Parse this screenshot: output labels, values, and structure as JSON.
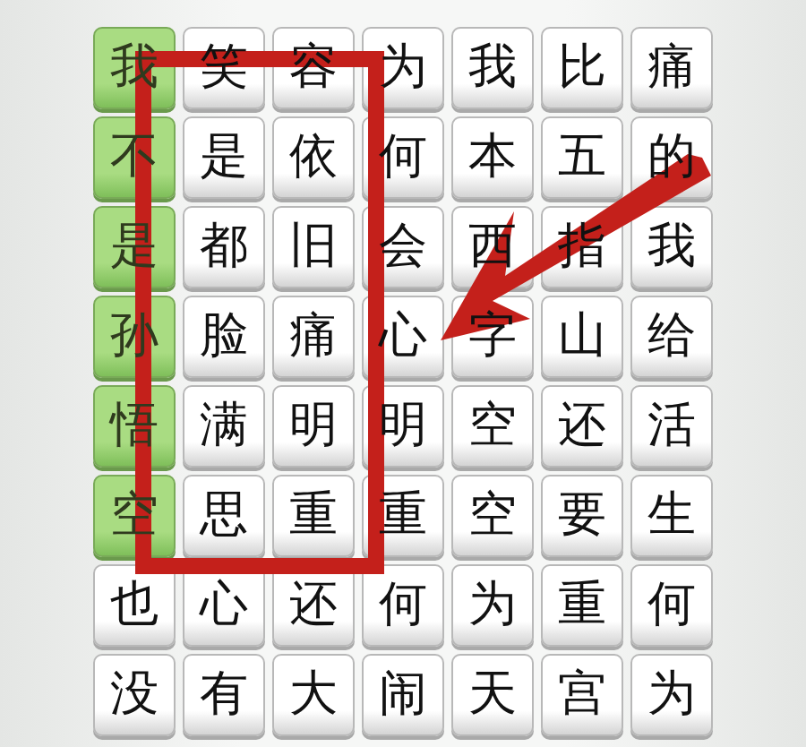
{
  "grid": [
    {
      "cells": [
        {
          "text": "我",
          "selected": true
        },
        {
          "text": "笑",
          "selected": false
        },
        {
          "text": "容",
          "selected": false
        },
        {
          "text": "为",
          "selected": false
        },
        {
          "text": "我",
          "selected": false
        },
        {
          "text": "比",
          "selected": false
        },
        {
          "text": "痛",
          "selected": false
        }
      ]
    },
    {
      "cells": [
        {
          "text": "不",
          "selected": true
        },
        {
          "text": "是",
          "selected": false
        },
        {
          "text": "依",
          "selected": false
        },
        {
          "text": "何",
          "selected": false
        },
        {
          "text": "本",
          "selected": false
        },
        {
          "text": "五",
          "selected": false
        },
        {
          "text": "的",
          "selected": false
        }
      ]
    },
    {
      "cells": [
        {
          "text": "是",
          "selected": true
        },
        {
          "text": "都",
          "selected": false
        },
        {
          "text": "旧",
          "selected": false
        },
        {
          "text": "会",
          "selected": false
        },
        {
          "text": "西",
          "selected": false
        },
        {
          "text": "指",
          "selected": false
        },
        {
          "text": "我",
          "selected": false
        }
      ]
    },
    {
      "cells": [
        {
          "text": "孙",
          "selected": true
        },
        {
          "text": "脸",
          "selected": false
        },
        {
          "text": "痛",
          "selected": false
        },
        {
          "text": "心",
          "selected": false
        },
        {
          "text": "字",
          "selected": false
        },
        {
          "text": "山",
          "selected": false
        },
        {
          "text": "给",
          "selected": false
        }
      ]
    },
    {
      "cells": [
        {
          "text": "悟",
          "selected": true
        },
        {
          "text": "满",
          "selected": false
        },
        {
          "text": "明",
          "selected": false
        },
        {
          "text": "明",
          "selected": false
        },
        {
          "text": "空",
          "selected": false
        },
        {
          "text": "还",
          "selected": false
        },
        {
          "text": "活",
          "selected": false
        }
      ]
    },
    {
      "cells": [
        {
          "text": "空",
          "selected": true
        },
        {
          "text": "思",
          "selected": false
        },
        {
          "text": "重",
          "selected": false
        },
        {
          "text": "重",
          "selected": false
        },
        {
          "text": "空",
          "selected": false
        },
        {
          "text": "要",
          "selected": false
        },
        {
          "text": "生",
          "selected": false
        }
      ]
    },
    {
      "cells": [
        {
          "text": "也",
          "selected": false
        },
        {
          "text": "心",
          "selected": false
        },
        {
          "text": "还",
          "selected": false
        },
        {
          "text": "何",
          "selected": false
        },
        {
          "text": "为",
          "selected": false
        },
        {
          "text": "重",
          "selected": false
        },
        {
          "text": "何",
          "selected": false
        }
      ]
    },
    {
      "cells": [
        {
          "text": "没",
          "selected": false
        },
        {
          "text": "有",
          "selected": false
        },
        {
          "text": "大",
          "selected": false
        },
        {
          "text": "闹",
          "selected": false
        },
        {
          "text": "天",
          "selected": false
        },
        {
          "text": "宫",
          "selected": false
        },
        {
          "text": "为",
          "selected": false
        }
      ]
    }
  ]
}
